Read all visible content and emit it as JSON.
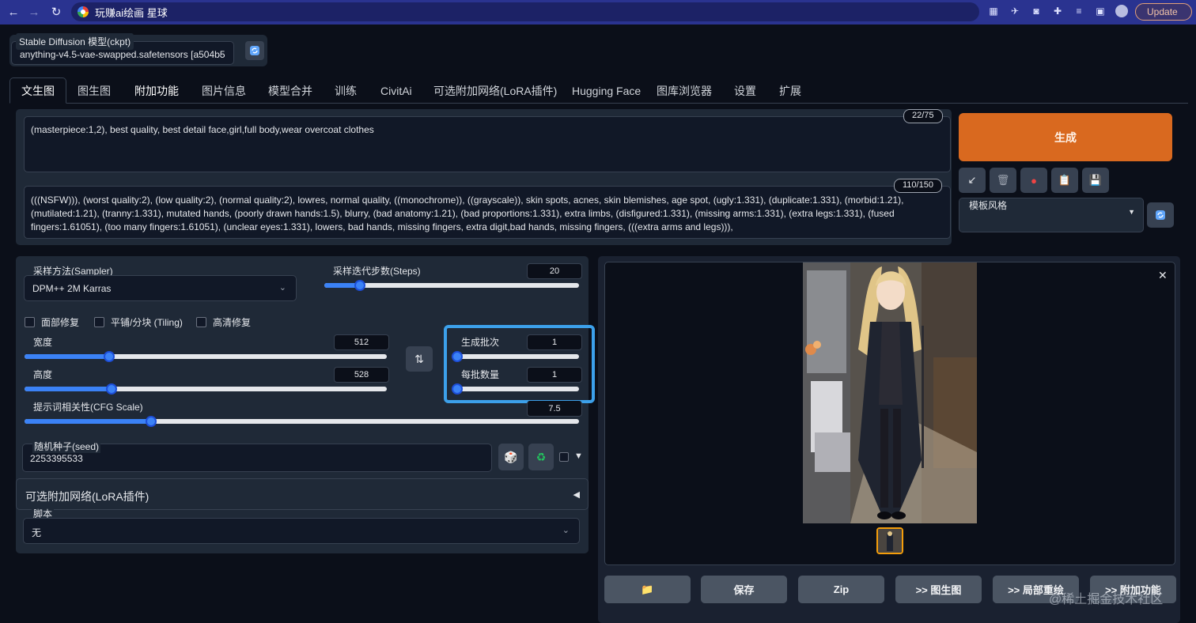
{
  "browser": {
    "tab_title": "玩赚ai绘画 星球",
    "update_label": "Update"
  },
  "checkpoint": {
    "label": "Stable Diffusion 模型(ckpt)",
    "value": "anything-v4.5-vae-swapped.safetensors [a504b5"
  },
  "tabs": [
    "文生图",
    "图生图",
    "附加功能",
    "图片信息",
    "模型合并",
    "训练",
    "CivitAi",
    "可选附加网络(LoRA插件)",
    "Hugging Face",
    "图库浏览器",
    "设置",
    "扩展"
  ],
  "prompt": {
    "positive": "(masterpiece:1,2), best quality, best detail face,girl,full body,wear overcoat clothes",
    "positive_count": "22/75",
    "negative": "(((NSFW))), (worst quality:2), (low quality:2), (normal quality:2), lowres, normal quality, ((monochrome)), ((grayscale)), skin spots, acnes, skin blemishes, age spot, (ugly:1.331), (duplicate:1.331), (morbid:1.21), (mutilated:1.21), (tranny:1.331), mutated hands, (poorly drawn hands:1.5), blurry, (bad anatomy:1.21), (bad proportions:1.331), extra limbs, (disfigured:1.331), (missing arms:1.331), (extra legs:1.331), (fused fingers:1.61051), (too many fingers:1.61051), (unclear eyes:1.331), lowers, bad hands, missing fingers, extra digit,bad hands, missing fingers, (((extra arms and legs))),",
    "negative_count": "110/150"
  },
  "generate_label": "生成",
  "style": {
    "label": "模板风格"
  },
  "params": {
    "sampler_label": "采样方法(Sampler)",
    "sampler_value": "DPM++ 2M Karras",
    "steps_label": "采样迭代步数(Steps)",
    "steps_value": "20",
    "steps_level": 0.2,
    "face_fix": "面部修复",
    "tiling": "平铺/分块 (Tiling)",
    "hires": "高清修复",
    "width_label": "宽度",
    "width_value": "512",
    "height_label": "高度",
    "height_value": "528",
    "batch_count_label": "生成批次",
    "batch_count_value": "1",
    "batch_size_label": "每批数量",
    "batch_size_value": "1",
    "cfg_label": "提示词相关性(CFG Scale)",
    "cfg_value": "7.5",
    "seed_label": "随机种子(seed)",
    "seed_value": "2253395533",
    "lora_label": "可选附加网络(LoRA插件)",
    "script_label": "脚本",
    "script_value": "无"
  },
  "actions": [
    "📁",
    "保存",
    "Zip",
    ">> 图生图",
    ">> 局部重绘",
    ">> 附加功能"
  ],
  "watermark": "@稀土掘金技术社区",
  "colors": {
    "accent": "#d9691f",
    "slider": "#3b82f6",
    "highlight": "#3ca0ea"
  }
}
